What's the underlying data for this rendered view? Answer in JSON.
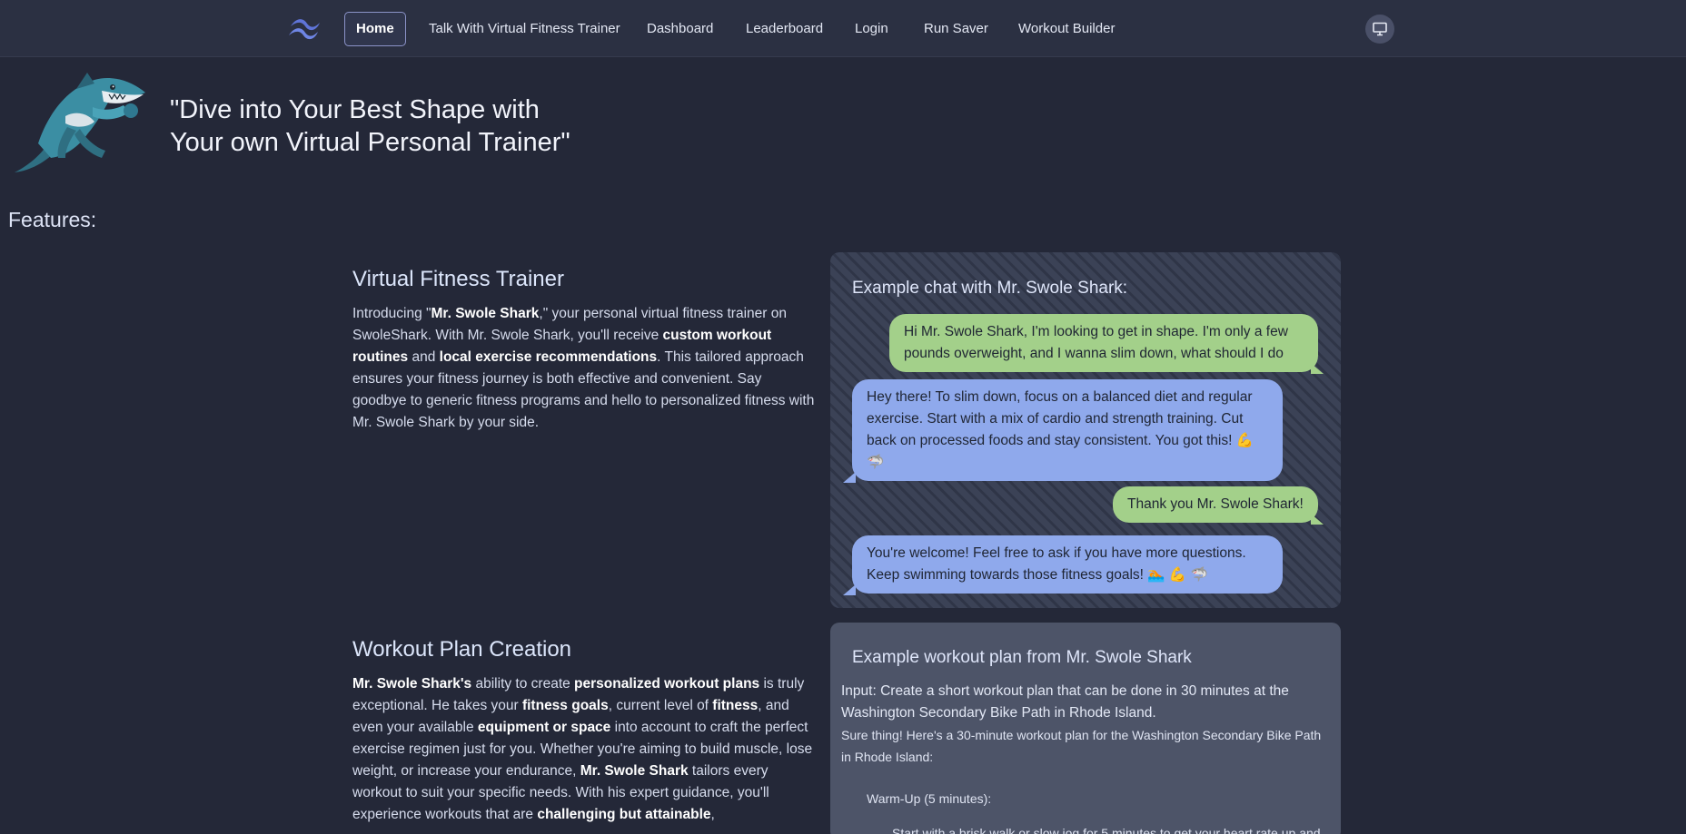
{
  "nav": {
    "items": [
      {
        "label": "Home",
        "active": true
      },
      {
        "label": "Talk With Virtual Fitness Trainer"
      },
      {
        "label": "Dashboard"
      },
      {
        "label": "Leaderboard"
      },
      {
        "label": "Login"
      },
      {
        "label": "Run Saver"
      },
      {
        "label": "Workout Builder"
      }
    ],
    "logo_icon": "tailwind-wave-icon",
    "right_icon": "monitor-icon"
  },
  "hero": {
    "mascot_icon": "shark-mascot",
    "title_line1": "\"Dive into Your Best Shape with",
    "title_line2": "Your own Virtual Personal Trainer\""
  },
  "features_label": "Features:",
  "sections": {
    "trainer": {
      "title": "Virtual Fitness Trainer",
      "body": [
        {
          "t": "Introducing \""
        },
        {
          "t": "Mr. Swole Shark",
          "b": true
        },
        {
          "t": ",\" your personal virtual fitness trainer on SwoleShark. With Mr. Swole Shark, you'll receive "
        },
        {
          "t": "custom workout routines",
          "b": true
        },
        {
          "t": " and "
        },
        {
          "t": "local exercise recommendations",
          "b": true
        },
        {
          "t": ". This tailored approach ensures your fitness journey is both effective and convenient. Say goodbye to generic fitness programs and hello to personalized fitness with Mr. Swole Shark by your side."
        }
      ]
    },
    "plan": {
      "title": "Workout Plan Creation",
      "body": [
        {
          "t": "Mr. Swole Shark's",
          "b": true
        },
        {
          "t": " ability to create "
        },
        {
          "t": "personalized workout plans",
          "b": true
        },
        {
          "t": " is truly exceptional. He takes your "
        },
        {
          "t": "fitness goals",
          "b": true
        },
        {
          "t": ", current level of "
        },
        {
          "t": "fitness",
          "b": true
        },
        {
          "t": ", and even your available "
        },
        {
          "t": "equipment or space",
          "b": true
        },
        {
          "t": " into account to craft the perfect exercise regimen just for you. Whether you're aiming to build muscle, lose weight, or increase your endurance, "
        },
        {
          "t": "Mr. Swole Shark",
          "b": true
        },
        {
          "t": " tailors every workout to suit your specific needs. With his expert guidance, you'll experience workouts that are "
        },
        {
          "t": "challenging but attainable",
          "b": true
        },
        {
          "t": ","
        }
      ]
    }
  },
  "chat": {
    "heading": "Example chat with Mr. Swole Shark:",
    "messages": [
      {
        "from": "user",
        "text": "Hi Mr. Swole Shark, I'm looking to get in shape. I'm only a few pounds overweight, and I wanna slim down, what should I do"
      },
      {
        "from": "bot",
        "text": "Hey there! To slim down, focus on a balanced diet and regular exercise. Start with a mix of cardio and strength training. Cut back on processed foods and stay consistent. You got this! 💪 🦈"
      },
      {
        "from": "user",
        "text": "Thank you Mr. Swole Shark!"
      },
      {
        "from": "bot",
        "text": "You're welcome! Feel free to ask if you have more questions. Keep swimming towards those fitness goals! 🏊 💪 🦈"
      }
    ]
  },
  "plan_example": {
    "heading": "Example workout plan from Mr. Swole Shark",
    "input": "Input: Create a short workout plan that can be done in 30 minutes at the Washington Secondary Bike Path in Rhode Island.",
    "reply": "Sure thing! Here's a 30-minute workout plan for the Washington Secondary Bike Path in Rhode Island:",
    "warmup": "Warm-Up (5 minutes):",
    "step1": "Start with a brisk walk or slow jog for 5 minutes to get your heart rate up and"
  },
  "colors": {
    "background": "#242838",
    "navbar": "#2b3042",
    "user_bubble": "#a3d08a",
    "bot_bubble": "#8fa9ec",
    "plan_panel": "#4d5468"
  }
}
